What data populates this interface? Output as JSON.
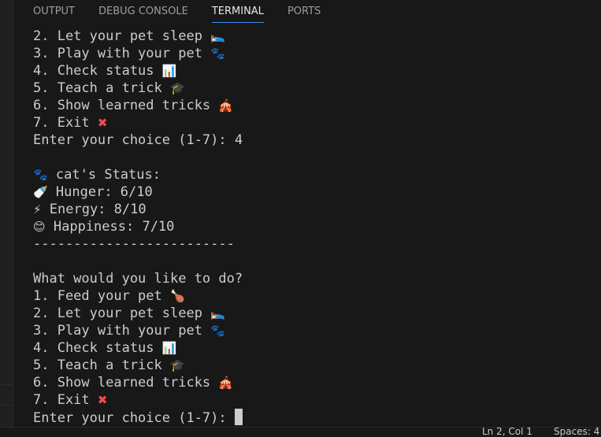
{
  "panel": {
    "tabs": [
      {
        "label": "OUTPUT",
        "active": false
      },
      {
        "label": "DEBUG CONSOLE",
        "active": false
      },
      {
        "label": "TERMINAL",
        "active": true
      },
      {
        "label": "PORTS",
        "active": false
      }
    ]
  },
  "terminal": {
    "lines": [
      {
        "text": "2. Let your pet sleep ",
        "icon": "🛌"
      },
      {
        "text": "3. Play with your pet ",
        "icon": "🐾"
      },
      {
        "text": "4. Check status ",
        "icon": "📊"
      },
      {
        "text": "5. Teach a trick ",
        "icon": "🎓"
      },
      {
        "text": "6. Show learned tricks ",
        "icon": "🎪"
      },
      {
        "text": "7. Exit ",
        "icon": "✖"
      },
      {
        "text": "Enter your choice (1-7): 4",
        "icon": ""
      },
      {
        "text": "",
        "icon": ""
      },
      {
        "text": " cat's Status:",
        "icon": "🐾",
        "icon_first": true
      },
      {
        "text": " Hunger: 6/10",
        "icon": "🍼",
        "icon_first": true
      },
      {
        "text": " Energy: 8/10",
        "icon": "⚡",
        "icon_first": true
      },
      {
        "text": " Happiness: 7/10",
        "icon": "😊",
        "icon_first": true
      },
      {
        "text": "-------------------------",
        "icon": ""
      },
      {
        "text": "",
        "icon": ""
      },
      {
        "text": "What would you like to do?",
        "icon": ""
      },
      {
        "text": "1. Feed your pet ",
        "icon": "🍗"
      },
      {
        "text": "2. Let your pet sleep ",
        "icon": "🛌"
      },
      {
        "text": "3. Play with your pet ",
        "icon": "🐾"
      },
      {
        "text": "4. Check status ",
        "icon": "📊"
      },
      {
        "text": "5. Teach a trick ",
        "icon": "🎓"
      },
      {
        "text": "6. Show learned tricks ",
        "icon": "🎪"
      },
      {
        "text": "7. Exit ",
        "icon": "✖"
      },
      {
        "text": "Enter your choice (1-7): ",
        "icon": "",
        "cursor": true
      }
    ]
  },
  "statusbar": {
    "position": "Ln 2, Col 1",
    "spaces": "Spaces: 4"
  }
}
